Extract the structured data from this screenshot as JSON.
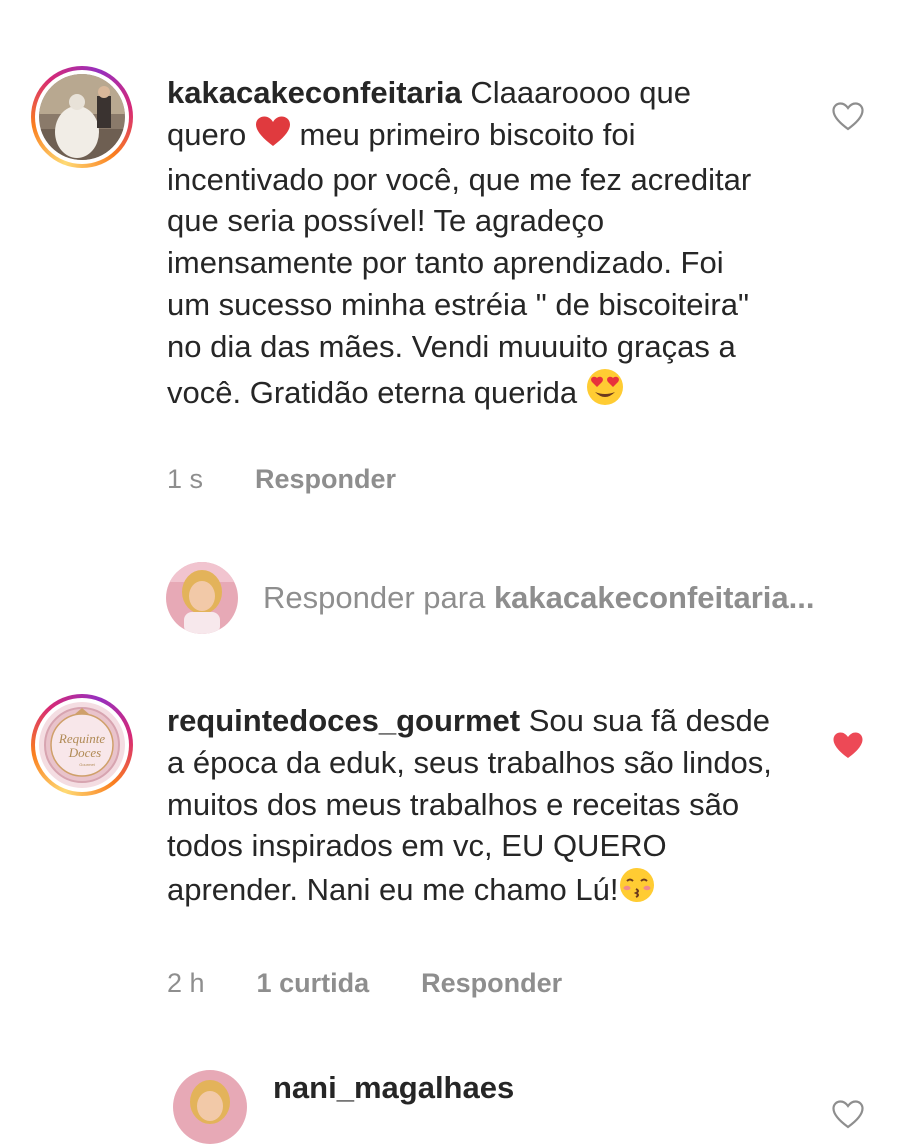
{
  "comments": [
    {
      "username": "kakacakeconfeitaria",
      "text_part1": " Claaaroooo que quero ",
      "emoji1": "red-heart-emoji",
      "text_part2": " meu primeiro biscoito foi incentivado por você, que me fez acreditar que seria possível! Te agradeço imensamente por tanto aprendizado. Foi um sucesso minha estréia \" de biscoiteira\" no dia das mães. Vendi muuuito graças a você. Gratidão eterna querida ",
      "emoji2": "heart-eyes-emoji",
      "time": "1 s",
      "reply_label": "Responder",
      "liked": false
    },
    {
      "username": "requintedoces_gourmet",
      "text_part1": " Sou sua fã desde a época da eduk, seus trabalhos são lindos, muitos dos meus trabalhos e receitas são todos inspirados em vc, EU QUERO aprender. Nani eu me chamo Lú!",
      "emoji1": "kissing-emoji",
      "time": "2 h",
      "likes": "1 curtida",
      "reply_label": "Responder",
      "liked": true
    }
  ],
  "reply_prompt": {
    "prefix": "Responder para ",
    "username": "kakacakeconfeitaria..."
  },
  "next_comment": {
    "username": "nani_magalhaes"
  },
  "colors": {
    "text": "#262626",
    "muted": "#8e8e8e",
    "like_red": "#ed4956"
  },
  "avatar2_logo": {
    "line1": "Requinte",
    "line2": "Doces",
    "line3": "Gourmet"
  }
}
